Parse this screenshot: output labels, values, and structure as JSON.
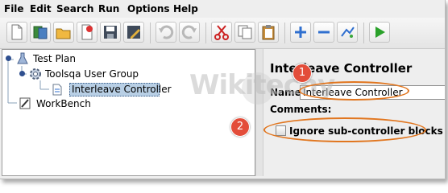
{
  "menu": [
    "File",
    "Edit",
    "Search",
    "Run",
    "Options",
    "Help"
  ],
  "toolbar": {
    "buttons": [
      "new-icon",
      "templates-icon",
      "open-icon",
      "close-icon",
      "save-icon",
      "save-as-icon",
      "undo-icon",
      "redo-icon",
      "cut-icon",
      "copy-icon",
      "paste-icon",
      "expand-icon",
      "collapse-icon",
      "toggle-icon",
      "start-icon"
    ]
  },
  "tree": {
    "nodes": [
      "Test Plan",
      "Toolsqa User Group",
      "Interleave Controller",
      "WorkBench"
    ],
    "selected": "Interleave Controller"
  },
  "editor": {
    "title": "Interleave Controller",
    "name_label": "Name:",
    "name_value": "Interleave Controller",
    "comments_label": "Comments:",
    "checkbox_label": "Ignore sub-controller blocks",
    "checkbox_checked": false
  },
  "annotations": {
    "badge1": "1",
    "badge2": "2",
    "accent": "#e1761f",
    "badge_color": "#e34d3a"
  },
  "watermark": "Wikitechy"
}
